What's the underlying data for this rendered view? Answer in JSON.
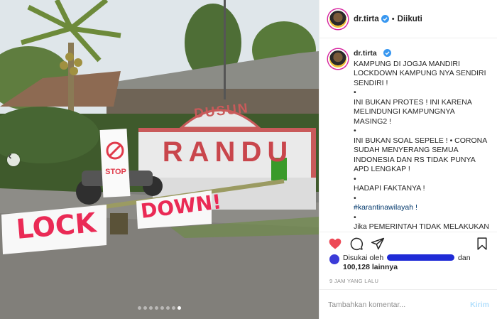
{
  "post": {
    "username": "dr.tirta",
    "follow_status": "Diikuti",
    "separator": "•"
  },
  "photo": {
    "sign_top": "DUSUN",
    "sign_main": "RANDU",
    "banner_left": "LOCK",
    "banner_right": "DOWN!",
    "placard": "STOP",
    "dot_count": 8,
    "active_dot": 8
  },
  "caption": {
    "username": "dr.tirta",
    "lines": [
      "KAMPUNG DI JOGJA MANDIRI LOCKDOWN KAMPUNG NYA SENDIRI SENDIRI !",
      "•",
      "INI BUKAN PROTES ! INI KARENA MELINDUNGI KAMPUNGNYA MASING2 !",
      "•",
      "INI BUKAN SOAL SEPELE ! • CORONA SUDAH MENYERANG SEMUA INDONESIA DAN RS TIDAK PUNYA APD LENGKAP !",
      "•",
      "HADAPI FAKTANYA !",
      "•"
    ],
    "hashtag": "#karantinawilayah !",
    "after": "•",
    "cutoff": "Jika PEMERINTAH TIDAK MELAKUKAN"
  },
  "likes": {
    "prefix": "Disukai oleh",
    "suffix": "dan",
    "count": "100,128 lainnya"
  },
  "time": "9 JAM YANG LALU",
  "comment": {
    "placeholder": "Tambahkan komentar...",
    "submit": "Kirim"
  },
  "colors": {
    "verified": "#3897f0",
    "like": "#ed4956",
    "link": "#00376b",
    "post_disabled": "#b2dffc"
  }
}
